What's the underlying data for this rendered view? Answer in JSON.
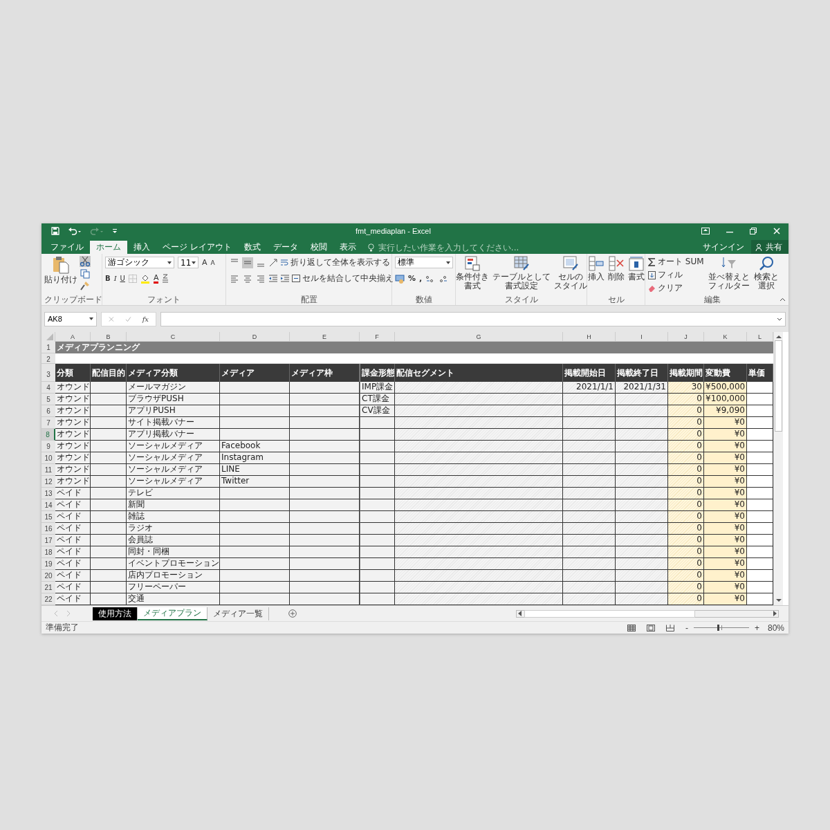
{
  "window": {
    "title": "fmt_mediaplan - Excel"
  },
  "tabs": [
    {
      "label": "ファイル",
      "selected": false
    },
    {
      "label": "ホーム",
      "selected": true
    },
    {
      "label": "挿入",
      "selected": false
    },
    {
      "label": "ページ レイアウト",
      "selected": false
    },
    {
      "label": "数式",
      "selected": false
    },
    {
      "label": "データ",
      "selected": false
    },
    {
      "label": "校閲",
      "selected": false
    },
    {
      "label": "表示",
      "selected": false
    }
  ],
  "tell_me": {
    "placeholder": "実行したい作業を入力してください..."
  },
  "account": {
    "sign_in": "サインイン",
    "share": "共有"
  },
  "ribbon": {
    "clipboard": {
      "paste": "貼り付け",
      "label": "クリップボード"
    },
    "font": {
      "name": "游ゴシック",
      "size": "11",
      "grow": "A",
      "shrink": "A",
      "bold": "B",
      "italic": "I",
      "underline": "U",
      "font_color": "A",
      "label": "フォント"
    },
    "alignment": {
      "wrap": "折り返して全体を表示する",
      "merge": "セルを結合して中央揃え",
      "label": "配置"
    },
    "number": {
      "format": "標準",
      "percent": "%",
      "comma": ",",
      "label": "数値"
    },
    "styles": {
      "buttons": [
        {
          "lines": [
            "条件付き",
            "書式"
          ]
        },
        {
          "lines": [
            "テーブルとして",
            "書式設定"
          ]
        },
        {
          "lines": [
            "セルの",
            "スタイル"
          ]
        }
      ],
      "label": "スタイル"
    },
    "cells": {
      "buttons": [
        "挿入",
        "削除",
        "書式"
      ],
      "label": "セル"
    },
    "editing": {
      "autosum": "オート SUM",
      "fill": "フィル",
      "clear": "クリア",
      "sort": {
        "lines": [
          "並べ替えと",
          "フィルター"
        ]
      },
      "find": {
        "lines": [
          "検索と",
          "選択"
        ]
      },
      "label": "編集"
    }
  },
  "formula_bar": {
    "name_box": "AK8",
    "function_label": "fx"
  },
  "sheet": {
    "columns": [
      {
        "letter": "A",
        "heading": "分類"
      },
      {
        "letter": "B",
        "heading": "配信目的"
      },
      {
        "letter": "C",
        "heading": "メディア分類"
      },
      {
        "letter": "D",
        "heading": "メディア"
      },
      {
        "letter": "E",
        "heading": "メディア枠"
      },
      {
        "letter": "F",
        "heading": "課金形態"
      },
      {
        "letter": "G",
        "heading": "配信セグメント"
      },
      {
        "letter": "H",
        "heading": "掲載開始日"
      },
      {
        "letter": "I",
        "heading": "掲載終了日"
      },
      {
        "letter": "J",
        "heading": "掲載期間"
      },
      {
        "letter": "K",
        "heading": "変動費"
      },
      {
        "letter": "L",
        "heading": "単価"
      }
    ],
    "title_row": {
      "num": "1",
      "text": "メディアプランニング"
    },
    "blank_row": {
      "num": "2"
    },
    "heading_row": {
      "num": "3"
    },
    "rows": [
      {
        "num": "4",
        "selected": false,
        "cells": {
          "A": "オウンド",
          "C": "メールマガジン",
          "F": "IMP課金",
          "H": "2021/1/1",
          "I": "2021/1/31",
          "J": "30",
          "K": "¥500,000"
        }
      },
      {
        "num": "5",
        "selected": false,
        "cells": {
          "A": "オウンド",
          "C": "ブラウザPUSH",
          "F": "CT課金",
          "J": "0",
          "K": "¥100,000"
        }
      },
      {
        "num": "6",
        "selected": false,
        "cells": {
          "A": "オウンド",
          "C": "アプリPUSH",
          "F": "CV課金",
          "J": "0",
          "K": "¥9,090"
        }
      },
      {
        "num": "7",
        "selected": false,
        "cells": {
          "A": "オウンド",
          "C": "サイト掲載バナー",
          "J": "0",
          "K": "¥0"
        }
      },
      {
        "num": "8",
        "selected": true,
        "cells": {
          "A": "オウンド",
          "C": "アプリ掲載バナー",
          "J": "0",
          "K": "¥0"
        }
      },
      {
        "num": "9",
        "selected": false,
        "cells": {
          "A": "オウンド",
          "C": "ソーシャルメディア",
          "D": "Facebook",
          "J": "0",
          "K": "¥0"
        }
      },
      {
        "num": "10",
        "selected": false,
        "cells": {
          "A": "オウンド",
          "C": "ソーシャルメディア",
          "D": "Instagram",
          "J": "0",
          "K": "¥0"
        }
      },
      {
        "num": "11",
        "selected": false,
        "cells": {
          "A": "オウンド",
          "C": "ソーシャルメディア",
          "D": "LINE",
          "J": "0",
          "K": "¥0"
        }
      },
      {
        "num": "12",
        "selected": false,
        "cells": {
          "A": "オウンド",
          "C": "ソーシャルメディア",
          "D": "Twitter",
          "J": "0",
          "K": "¥0"
        }
      },
      {
        "num": "13",
        "selected": false,
        "cells": {
          "A": "ペイド",
          "C": "テレビ",
          "J": "0",
          "K": "¥0"
        }
      },
      {
        "num": "14",
        "selected": false,
        "cells": {
          "A": "ペイド",
          "C": "新聞",
          "J": "0",
          "K": "¥0"
        }
      },
      {
        "num": "15",
        "selected": false,
        "cells": {
          "A": "ペイド",
          "C": "雑誌",
          "J": "0",
          "K": "¥0"
        }
      },
      {
        "num": "16",
        "selected": false,
        "cells": {
          "A": "ペイド",
          "C": "ラジオ",
          "J": "0",
          "K": "¥0"
        }
      },
      {
        "num": "17",
        "selected": false,
        "cells": {
          "A": "ペイド",
          "C": "会員誌",
          "J": "0",
          "K": "¥0"
        }
      },
      {
        "num": "18",
        "selected": false,
        "cells": {
          "A": "ペイド",
          "C": "同封・同梱",
          "J": "0",
          "K": "¥0"
        }
      },
      {
        "num": "19",
        "selected": false,
        "cells": {
          "A": "ペイド",
          "C": "イベントプロモーション",
          "J": "0",
          "K": "¥0"
        }
      },
      {
        "num": "20",
        "selected": false,
        "cells": {
          "A": "ペイド",
          "C": "店内プロモーション",
          "J": "0",
          "K": "¥0"
        }
      },
      {
        "num": "21",
        "selected": false,
        "cells": {
          "A": "ペイド",
          "C": "フリーペーパー",
          "J": "0",
          "K": "¥0"
        }
      },
      {
        "num": "22",
        "selected": false,
        "cells": {
          "A": "ペイド",
          "C": "交通",
          "J": "0",
          "K": "¥0"
        }
      }
    ]
  },
  "sheet_tabs": [
    {
      "label": "使用方法",
      "selected": false,
      "color": "#000000"
    },
    {
      "label": "メディアプラン",
      "selected": true
    },
    {
      "label": "メディア一覧",
      "selected": false
    }
  ],
  "status_bar": {
    "status": "準備完了",
    "zoom_out": "-",
    "zoom_in": "+",
    "zoom": "80%",
    "level": 0.44
  }
}
